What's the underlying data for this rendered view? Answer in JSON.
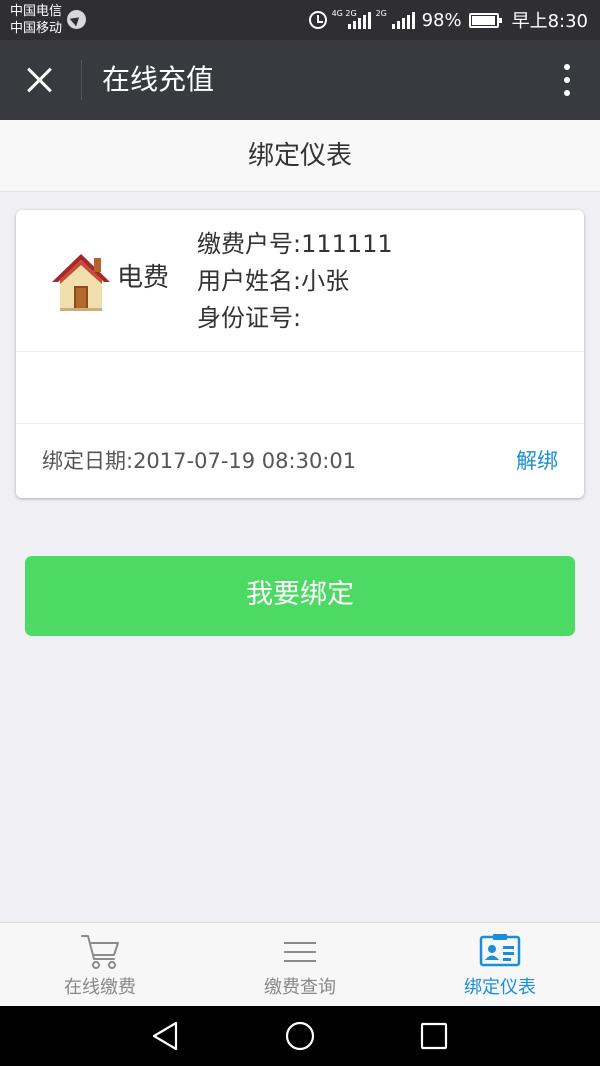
{
  "status_bar": {
    "carrier_1": "中国电信",
    "carrier_2": "中国移动",
    "network_1": "4G 2G",
    "network_2": "2G",
    "battery": "98%",
    "battery_level": 0.98,
    "time": "早上8:30"
  },
  "title_bar": {
    "title": "在线充值"
  },
  "page": {
    "header": "绑定仪表"
  },
  "meter_card": {
    "type_label": "电费",
    "account_number": "缴费户号:111111",
    "user_name": "用户姓名:小张",
    "id_number": "身份证号:",
    "bind_date": "绑定日期:2017-07-19 08:30:01",
    "unbind_label": "解绑"
  },
  "bind_button": {
    "label": "我要绑定"
  },
  "tabs": [
    {
      "label": "在线缴费",
      "icon": "cart-icon",
      "active": false
    },
    {
      "label": "缴费查询",
      "icon": "list-icon",
      "active": false
    },
    {
      "label": "绑定仪表",
      "icon": "id-card-icon",
      "active": true
    }
  ],
  "colors": {
    "title_bar": "#393a3f",
    "primary_button": "#4cd964",
    "active_tab": "#1a8ed8",
    "link": "#1a8ed8"
  }
}
